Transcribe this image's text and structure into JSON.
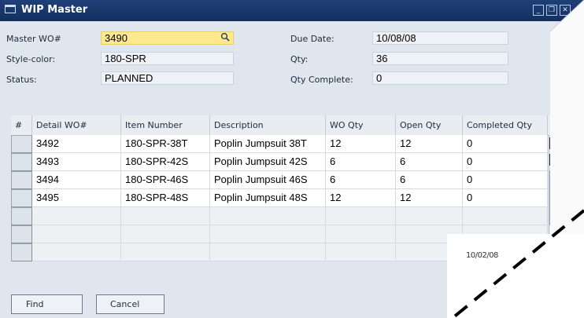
{
  "window": {
    "title": "WIP Master",
    "buttons": [
      "minimize-icon",
      "maximize-icon",
      "close-icon"
    ]
  },
  "header": {
    "master_wo_label": "Master WO#",
    "master_wo_value": "3490",
    "style_color_label": "Style-color:",
    "style_color_value": "180-SPR",
    "status_label": "Status:",
    "status_value": "PLANNED",
    "due_date_label": "Due Date:",
    "due_date_value": "10/08/08",
    "qty_label": "Qty:",
    "qty_value": "36",
    "qty_complete_label": "Qty Complete:",
    "qty_complete_value": "0"
  },
  "table": {
    "columns": [
      "#",
      "Detail WO#",
      "Item Number",
      "Description",
      "WO Qty",
      "Open Qty",
      "Completed Qty"
    ],
    "rows": [
      {
        "detail_wo": "3492",
        "item": "180-SPR-38T",
        "description": "Poplin Jumpsuit 38T",
        "wo_qty": "12",
        "open_qty": "12",
        "completed": "0"
      },
      {
        "detail_wo": "3493",
        "item": "180-SPR-42S",
        "description": "Poplin Jumpsuit 42S",
        "wo_qty": "6",
        "open_qty": "6",
        "completed": "0"
      },
      {
        "detail_wo": "3494",
        "item": "180-SPR-46S",
        "description": "Poplin Jumpsuit 46S",
        "wo_qty": "6",
        "open_qty": "6",
        "completed": "0"
      },
      {
        "detail_wo": "3495",
        "item": "180-SPR-48S",
        "description": "Poplin Jumpsuit 48S",
        "wo_qty": "12",
        "open_qty": "12",
        "completed": "0"
      }
    ]
  },
  "buttons": {
    "find": "Find",
    "cancel": "Cancel"
  },
  "overlay": {
    "date_text": "10/02/08"
  },
  "colors": {
    "titlebar": "#1f3f78",
    "window_bg": "#dfe6ee",
    "active_field": "#ffe98f"
  },
  "icons": {
    "lookup": "magnifier-icon",
    "window": "window-icon"
  }
}
